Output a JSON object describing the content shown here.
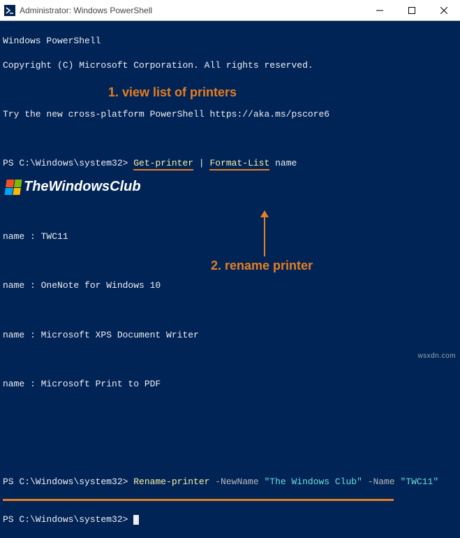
{
  "titlebar": {
    "title": "Administrator: Windows PowerShell"
  },
  "terminal": {
    "banner_line1": "Windows PowerShell",
    "banner_line2": "Copyright (C) Microsoft Corporation. All rights reserved.",
    "banner_line3": "Try the new cross-platform PowerShell https://aka.ms/pscore6",
    "prompt": "PS C:\\Windows\\system32> ",
    "cmd1_a": "Get-printer",
    "cmd1_pipe": " | ",
    "cmd1_b": "Format-List",
    "cmd1_arg": " name",
    "printers": {
      "p1": "name : TWC11",
      "p2": "name : OneNote for Windows 10",
      "p3": "name : Microsoft XPS Document Writer",
      "p4": "name : Microsoft Print to PDF"
    },
    "cmd2_cmdlet": "Rename-printer",
    "cmd2_paramNewName": " -NewName ",
    "cmd2_valNewName": "\"The Windows Club\"",
    "cmd2_paramName": " -Name ",
    "cmd2_valName": "\"TWC11\""
  },
  "annotations": {
    "a1": "1. view list of printers",
    "a2": "2. rename printer"
  },
  "watermark": {
    "text": "TheWindowsClub"
  },
  "footer": "wsxdn.com"
}
